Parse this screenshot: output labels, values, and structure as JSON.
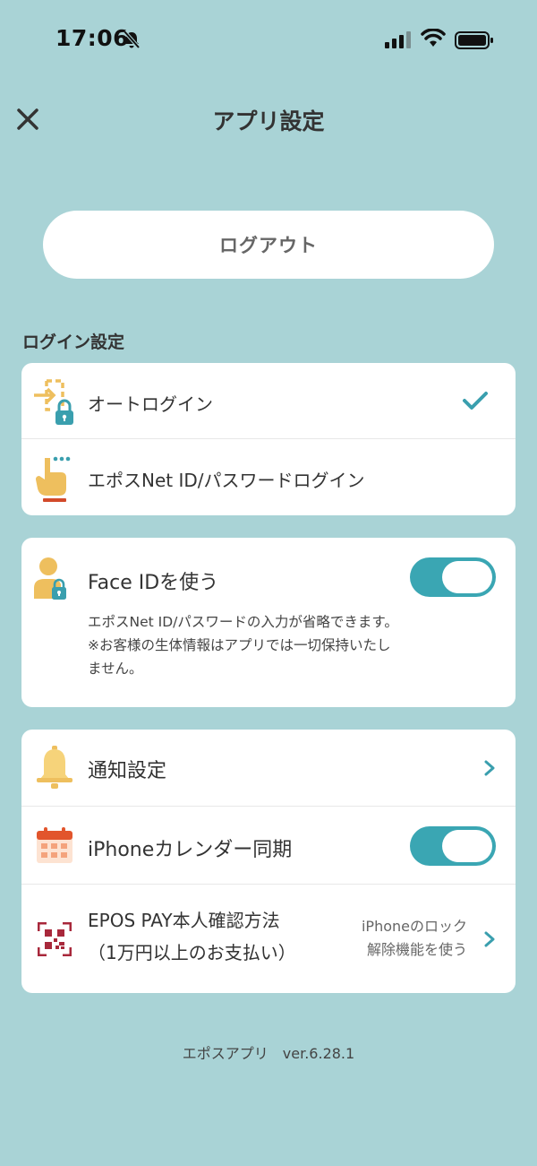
{
  "status": {
    "time": "17:06"
  },
  "header": {
    "title": "アプリ設定"
  },
  "logout": {
    "label": "ログアウト"
  },
  "login_section": {
    "label": "ログイン設定",
    "items": [
      {
        "label": "オートログイン",
        "selected": true
      },
      {
        "label": "エポスNet ID/パスワードログイン",
        "selected": false
      }
    ]
  },
  "face_id": {
    "label": "Face IDを使う",
    "enabled": true,
    "description_line1": "エポスNet ID/パスワードの入力が省略できます。",
    "description_line2": "※お客様の生体情報はアプリでは一切保持いたし",
    "description_line3": "ません。"
  },
  "settings": {
    "notification": {
      "label": "通知設定"
    },
    "calendar": {
      "label": "iPhoneカレンダー同期",
      "enabled": true
    },
    "epos_pay": {
      "label_line1": "EPOS PAY本人確認方法",
      "label_line2": "（1万円以上のお支払い）",
      "value_line1": "iPhoneのロック",
      "value_line2": "解除機能を使う"
    }
  },
  "footer": {
    "version": "エポスアプリ　ver.6.28.1"
  },
  "colors": {
    "background": "#a9d3d6",
    "accent": "#3aa6b3",
    "icon_yellow": "#eebf5e",
    "icon_teal": "#3a9fae"
  }
}
